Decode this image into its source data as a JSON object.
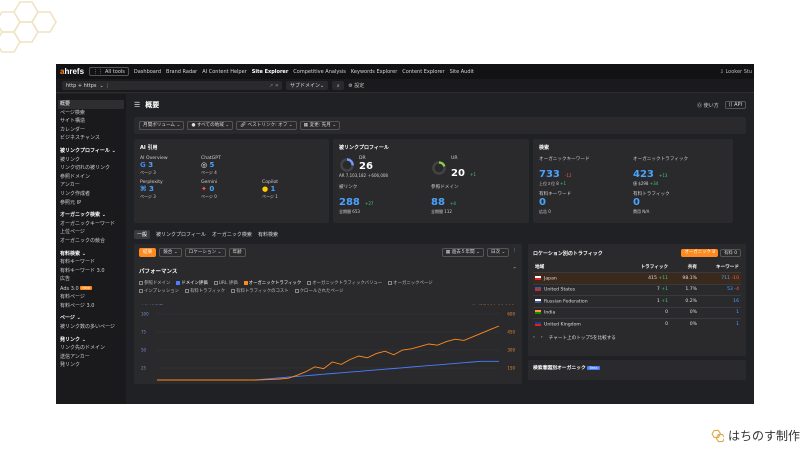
{
  "brand": {
    "text": "はちのす制作"
  },
  "app": {
    "logo": "ahrefs",
    "all_tools": "All tools",
    "nav": [
      "Dashboard",
      "Brand Radar",
      "AI Content Helper",
      "Site Explorer",
      "Competitive Analysis",
      "Keywords Explorer",
      "Content Explorer",
      "Site Audit"
    ],
    "nav_right": "Looker Stu",
    "url": {
      "protocol": "http + https",
      "mode": "サブドメイン",
      "settings": "設定"
    }
  },
  "sidebar": [
    {
      "label": "概要",
      "active": true
    },
    {
      "label": "ページ検索"
    },
    {
      "label": "サイト構造"
    },
    {
      "label": "カレンダー"
    },
    {
      "label": "ビジネスチャンス"
    },
    {
      "label": "被リンクプロフィール",
      "header": true
    },
    {
      "label": "被リンク"
    },
    {
      "label": "リンク切れの被リンク"
    },
    {
      "label": "参照ドメイン"
    },
    {
      "label": "アンカー"
    },
    {
      "label": "リンク作成者"
    },
    {
      "label": "参照元 IP"
    },
    {
      "label": "オーガニック検索",
      "header": true
    },
    {
      "label": "オーガニックキーワード"
    },
    {
      "label": "上位ページ"
    },
    {
      "label": "オーガニックの競合"
    },
    {
      "label": "有料検索",
      "header": true
    },
    {
      "label": "有料キーワード"
    },
    {
      "label": "有料キーワード 3.0"
    },
    {
      "label": "広告"
    },
    {
      "label": "Ads 3.0",
      "badge": "New"
    },
    {
      "label": "有料ページ"
    },
    {
      "label": "有料ページ 3.0"
    },
    {
      "label": "ページ",
      "header": true
    },
    {
      "label": "被リンク数の多いページ"
    },
    {
      "label": "発リンク",
      "header": true
    },
    {
      "label": "リンク先のドメイン"
    },
    {
      "label": "送信アンカー"
    },
    {
      "label": "発リンク"
    }
  ],
  "page": {
    "title": "概要",
    "help": "使い方",
    "api": "API",
    "filters": [
      "月間ボリューム",
      "すべての地域",
      "ベストリンク: オフ",
      "変更: 先月"
    ]
  },
  "ai_card": {
    "title": "AI 引用",
    "items": [
      {
        "name": "AI Overview",
        "icon": "G",
        "value": "3",
        "sub": "ページ 3"
      },
      {
        "name": "ChatGPT",
        "icon": "◎",
        "value": "5",
        "sub": "ページ 4"
      },
      {
        "name": "",
        "icon": "",
        "value": "",
        "sub": ""
      },
      {
        "name": "Perplexity",
        "icon": "⌘",
        "value": "3",
        "sub": "ページ 3"
      },
      {
        "name": "Gemini",
        "icon": "✦",
        "value": "0",
        "sub": "ページ 0"
      },
      {
        "name": "Copilot",
        "icon": "●",
        "value": "1",
        "sub": "ページ 1"
      }
    ]
  },
  "backlink_card": {
    "title": "被リンクプロフィール",
    "dr_label": "DR",
    "dr": "26",
    "ar": "AR 7,103,182 ＋606,008",
    "ur_label": "UR",
    "ur": "20",
    "ur_change": "+1",
    "backlinks_label": "被リンク",
    "backlinks": "288",
    "backlinks_change": "+27",
    "backlinks_sub": "全期間 653",
    "domains_label": "参照ドメイン",
    "domains": "88",
    "domains_change": "+4",
    "domains_sub": "全期間 112"
  },
  "search_card": {
    "title": "検索",
    "ok_label": "オーガニックキーワード",
    "ok": "733",
    "ok_change": "-12",
    "ok_sub": "上位３位 8",
    "ok_sub_change": "+1",
    "ot_label": "オーガニックトラフィック",
    "ot": "423",
    "ot_change": "+13",
    "ot_sub": "値 $298",
    "ot_sub_change": "+34",
    "pk_label": "有料キーワード",
    "pk": "0",
    "pk_sub": "広告 0",
    "pt_label": "有料トラフィック",
    "pt": "0",
    "pt_sub": "費用 N/A"
  },
  "tabs2": [
    "一般",
    "被リンクプロフィール",
    "オーガニック検索",
    "有料検索"
  ],
  "perf": {
    "toolbar": [
      "結果",
      "競合",
      "ロケーション",
      "年齢"
    ],
    "range": "過去５年間",
    "interval": "日次",
    "title": "パフォーマンス",
    "legend": [
      {
        "label": "参照ドメイン",
        "state": "off"
      },
      {
        "label": "ドメイン評価",
        "state": "blue"
      },
      {
        "label": "URL 評価",
        "state": "off"
      },
      {
        "label": "オーガニックトラフィック",
        "state": "orange"
      },
      {
        "label": "オーガニックトラフィックバリュー",
        "state": "off"
      },
      {
        "label": "オーガニックページ",
        "state": "off"
      },
      {
        "label": "インプレッション",
        "state": "off"
      },
      {
        "label": "有料トラフィック",
        "state": "off"
      },
      {
        "label": "有料トラフィックのコスト",
        "state": "off"
      },
      {
        "label": "クロールされたページ",
        "state": "off"
      }
    ],
    "axis_left_label": "ドメイン評価",
    "axis_right_label": "オーガニックトラフィック",
    "left_ticks": [
      "100",
      "75",
      "50",
      "25"
    ],
    "right_ticks": [
      "600",
      "450",
      "300",
      "150"
    ]
  },
  "traffic": {
    "title": "ロケーション別のトラフィック",
    "organic": "オーガニック",
    "organic_count": "8",
    "paid": "有料",
    "paid_count": "0",
    "headers": [
      "地域",
      "トラフィック",
      "共有",
      "キーワード"
    ],
    "rows": [
      {
        "country": "Japan",
        "traffic": "415",
        "traffic_change": "+11",
        "share": "98.1%",
        "kw": "711",
        "kw_change": "-10",
        "highlight": true,
        "flag": "jp"
      },
      {
        "country": "United States",
        "traffic": "7",
        "traffic_change": "+1",
        "share": "1.7%",
        "kw": "53",
        "kw_change": "-4",
        "flag": "us"
      },
      {
        "country": "Russian Federation",
        "traffic": "1",
        "traffic_change": "+1",
        "share": "0.2%",
        "kw": "16",
        "kw_change": "",
        "flag": "ru"
      },
      {
        "country": "India",
        "traffic": "0",
        "traffic_change": "",
        "share": "0%",
        "kw": "1",
        "kw_change": "",
        "flag": "in"
      },
      {
        "country": "United Kingdom",
        "traffic": "0",
        "traffic_change": "",
        "share": "0%",
        "kw": "1",
        "kw_change": "",
        "flag": "uk"
      }
    ],
    "compare": "チャート上のトップ5を比較する"
  },
  "organic_panel": {
    "title": "検索意図別オーガニック",
    "badge": "Beta"
  },
  "chart_data": {
    "type": "line",
    "series": [
      {
        "name": "ドメイン評価",
        "axis": "left",
        "color": "#4a7dff",
        "values": [
          0,
          0,
          0,
          0,
          0,
          0,
          0,
          0,
          0,
          0,
          0,
          0,
          1,
          2,
          3,
          4,
          5,
          6,
          7,
          8,
          9,
          10,
          11,
          12,
          13,
          14,
          15,
          16,
          17,
          18,
          19,
          20,
          21,
          22,
          23,
          24,
          25,
          26,
          26,
          26
        ]
      },
      {
        "name": "オーガニックトラフィック",
        "axis": "right",
        "color": "#ff8a1f",
        "values": [
          0,
          0,
          0,
          0,
          0,
          0,
          0,
          0,
          0,
          0,
          0,
          0,
          2,
          5,
          8,
          15,
          40,
          70,
          110,
          95,
          150,
          130,
          170,
          200,
          185,
          220,
          240,
          210,
          250,
          260,
          280,
          300,
          290,
          320,
          340,
          330,
          360,
          390,
          420,
          450
        ]
      }
    ],
    "ylim_left": [
      0,
      100
    ],
    "ylim_right": [
      0,
      600
    ]
  }
}
